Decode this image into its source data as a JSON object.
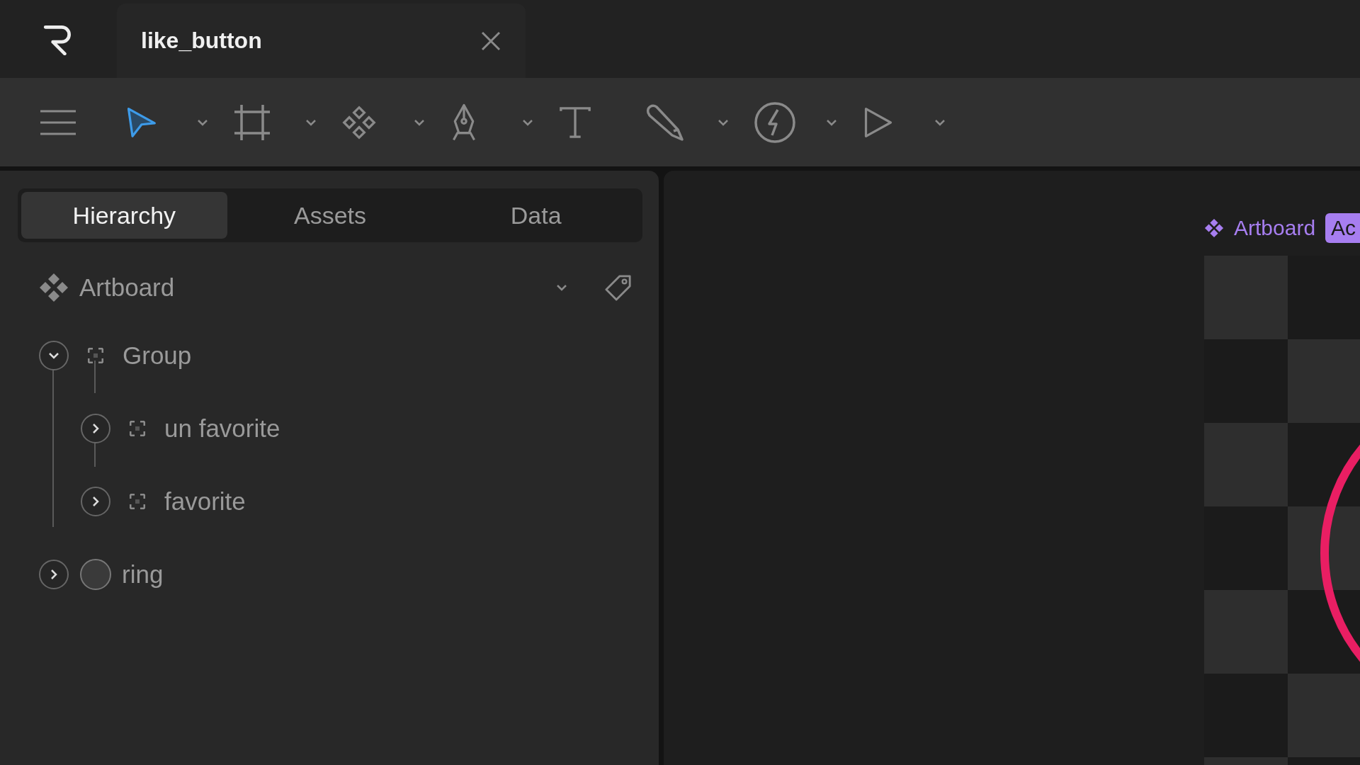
{
  "document_tab": {
    "title": "like_button"
  },
  "toolbar": {
    "tools": [
      {
        "kind": "select",
        "selected": true,
        "dropdown": true
      },
      {
        "kind": "frame",
        "selected": false,
        "dropdown": true
      },
      {
        "kind": "component",
        "selected": false,
        "dropdown": true
      },
      {
        "kind": "pen",
        "selected": false,
        "dropdown": true
      },
      {
        "kind": "text",
        "selected": false,
        "dropdown": false
      },
      {
        "kind": "brush",
        "selected": false,
        "dropdown": true
      },
      {
        "kind": "event",
        "selected": false,
        "dropdown": true
      },
      {
        "kind": "play",
        "selected": false,
        "dropdown": true
      }
    ]
  },
  "panel_tabs": [
    {
      "label": "Hierarchy",
      "selected": true
    },
    {
      "label": "Assets",
      "selected": false
    },
    {
      "label": "Data",
      "selected": false
    }
  ],
  "artboard_selector": {
    "name": "Artboard"
  },
  "layers": [
    {
      "name": "Group",
      "kind": "group",
      "expanded": true,
      "children": [
        {
          "name": "un favorite",
          "kind": "group",
          "expanded": false
        },
        {
          "name": "favorite",
          "kind": "group",
          "expanded": false
        }
      ]
    },
    {
      "name": "ring",
      "kind": "ellipse",
      "expanded": false
    }
  ],
  "canvas": {
    "artboard_label": "Artboard",
    "badge": "Ac"
  }
}
